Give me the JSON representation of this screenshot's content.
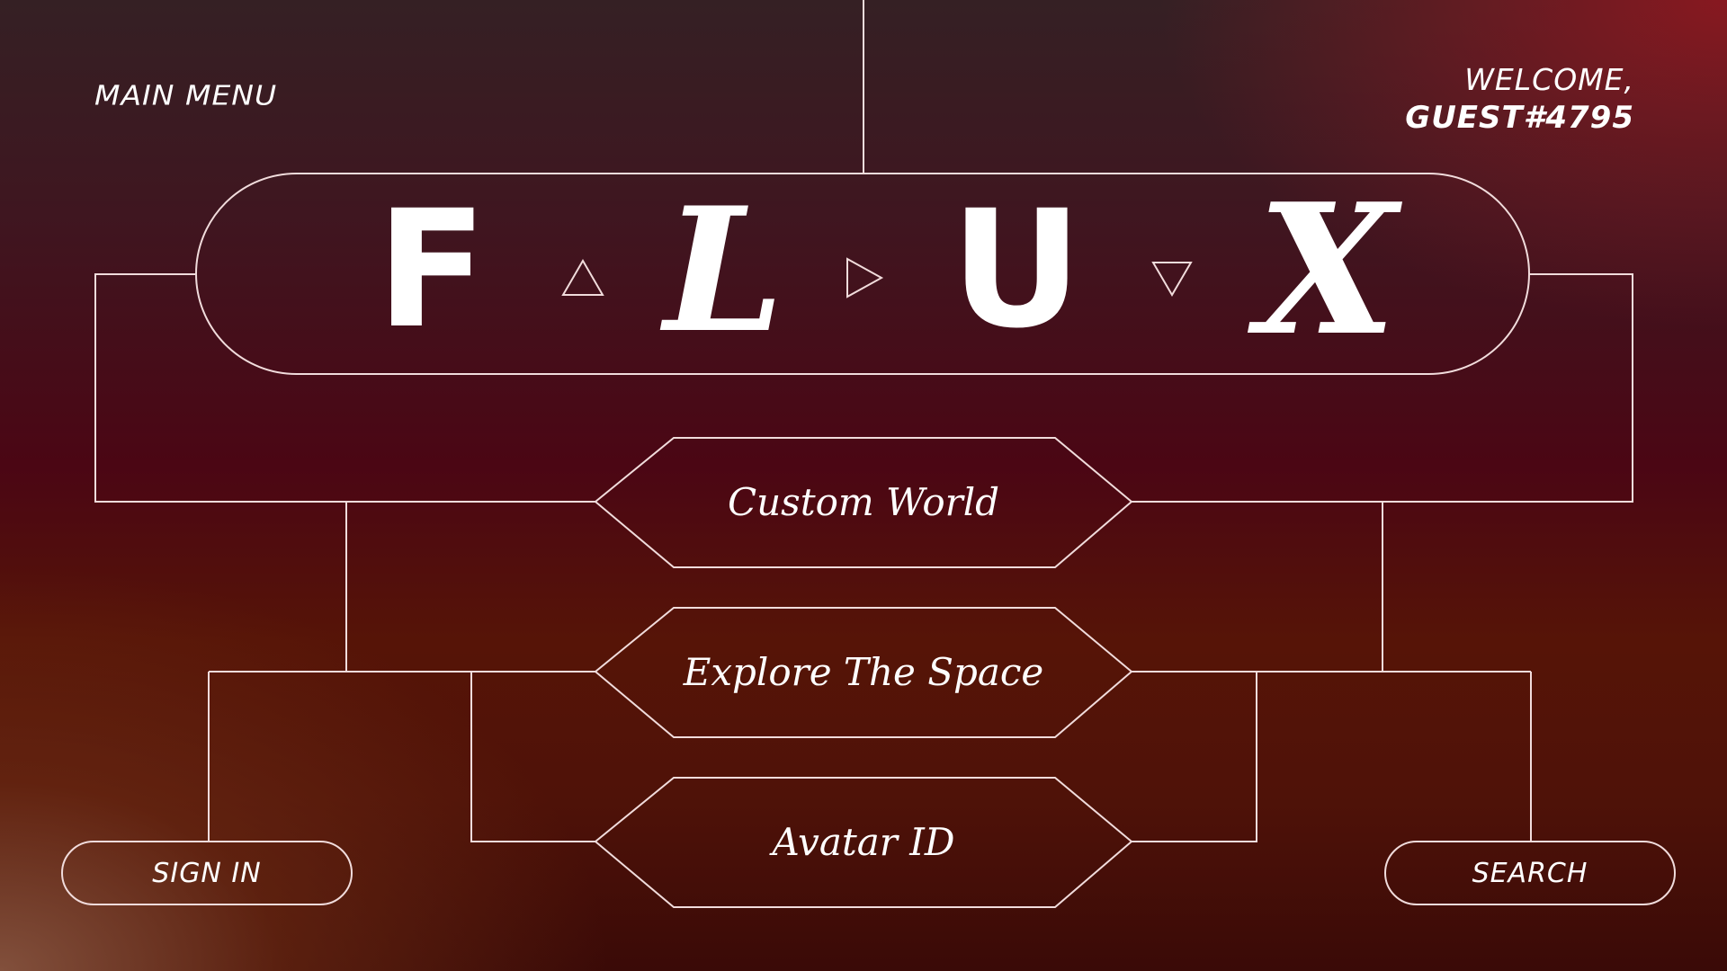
{
  "header": {
    "menu_title": "MAIN MENU",
    "welcome_line1": "WELCOME,",
    "welcome_line2": "GUEST#4795"
  },
  "logo": {
    "letters": [
      "F",
      "L",
      "U",
      "X"
    ],
    "separators": [
      "triangle-up-icon",
      "triangle-right-icon",
      "triangle-down-icon"
    ]
  },
  "menu": {
    "items": [
      {
        "label": "Custom World"
      },
      {
        "label": "Explore The Space"
      },
      {
        "label": "Avatar ID"
      }
    ]
  },
  "buttons": {
    "sign_in": "SIGN IN",
    "search": "SEARCH"
  },
  "colors": {
    "line": "#f1dcdc",
    "text": "#ffffff",
    "accent_red": "#8c1820",
    "deep_maroon": "#4b0614"
  }
}
